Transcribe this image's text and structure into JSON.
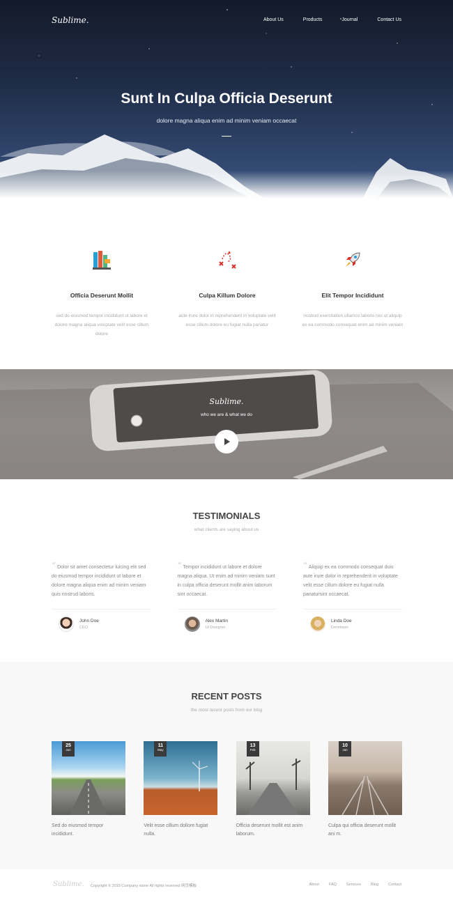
{
  "header": {
    "logo": "Sublime.",
    "nav": [
      "About Us",
      "Products",
      "Journal",
      "Contact Us"
    ]
  },
  "hero": {
    "title": "Sunt In Culpa Officia Deserunt",
    "subtitle": "dolore magna aliqua enim ad minim veniam occaecat"
  },
  "features": [
    {
      "icon": "books-icon",
      "title": "Officia Deserunt Mollit",
      "text": "sed do eiusmod tempor incididunt ut labore et dolore magna aliqua voluptate velit esse cillum dolore"
    },
    {
      "icon": "strategy-icon",
      "title": "Culpa Killum Dolore",
      "text": "aute irure dolor in reprehenderit in voluptate velit esse cillum dolore eu fugiat nulla pariatur"
    },
    {
      "icon": "rocket-icon",
      "title": "Elit Tempor Incididunt",
      "text": "nostrud exercitation ullamco laboris nisi ut aliquip ex ea commodo consequat enim ad minim veniam"
    }
  ],
  "video": {
    "logo": "Sublime.",
    "tagline": "who we are & what we do"
  },
  "testimonials": {
    "title": "TESTIMONIALS",
    "subtitle": "what clients are saying about us",
    "items": [
      {
        "quote": "Dolor sit amet consectetur luicing elit sed do eiusmod tempor incididunt ut labore et dolore magna aliqua enim ad minim veniam quis nostrud laboris.",
        "name": "John Doe",
        "role": "CEO"
      },
      {
        "quote": "Tempor incididunt ut labore et dolore magna aliqua. Ut enim ad minim veniam sunt in culpa officia deserunt mollit anim laborum sint occaecat.",
        "name": "Alex Martin",
        "role": "UI Designer"
      },
      {
        "quote": "Aliquip ex ea commodo consequat duis aute irure dolor in reprehenderit in voluptate velit esse cillum dolore eu fugiat nulla pariatursint occaecat.",
        "name": "Linda Doe",
        "role": "Developer"
      }
    ]
  },
  "posts": {
    "title": "RECENT POSTS",
    "subtitle": "the most recent posts from our blog",
    "items": [
      {
        "day": "25",
        "month": "Jun",
        "text": "Sed do eiusmod tempor incididunt."
      },
      {
        "day": "11",
        "month": "May",
        "text": "Velit esse cillum dollore fugiat nulla."
      },
      {
        "day": "13",
        "month": "Feb",
        "text": "Officia deserunt mollit est anim laborum."
      },
      {
        "day": "10",
        "month": "Jan",
        "text": "Culpa qui officia deserunt mollit ani m."
      }
    ]
  },
  "footer": {
    "logo": "Sublime.",
    "copyright": "Copyright © 2015 Company name All rights reserved 网页模板",
    "nav": [
      "About",
      "FAQ",
      "Services",
      "Blog",
      "Contact"
    ]
  }
}
